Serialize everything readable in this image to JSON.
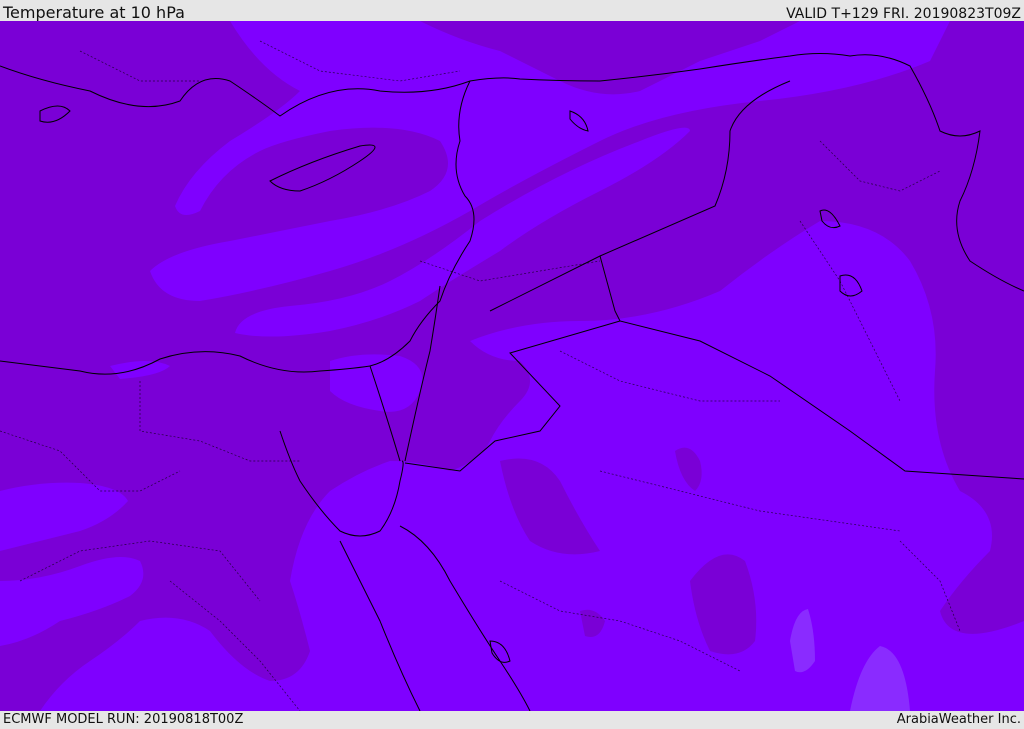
{
  "header": {
    "title": "Temperature at 10 hPa",
    "valid": "VALID T+129 FRI. 20190823T09Z"
  },
  "footer": {
    "model_run": "ECMWF MODEL RUN: 20190818T00Z",
    "brand": "ArabiaWeather Inc."
  },
  "map": {
    "colors": {
      "background": "#7a00d6",
      "warm_band": "#7f00ff",
      "warmest": "#8a2bff",
      "coastline": "#000000",
      "border": "#000000"
    }
  }
}
